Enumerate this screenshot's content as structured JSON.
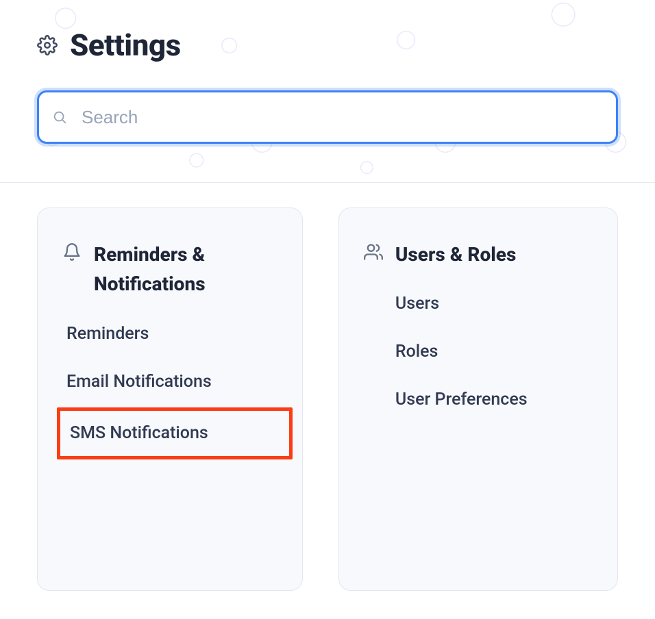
{
  "page": {
    "title": "Settings"
  },
  "search": {
    "placeholder": "Search",
    "value": ""
  },
  "cards": {
    "reminders": {
      "title": "Reminders & Notifications",
      "items": [
        {
          "label": "Reminders",
          "highlighted": false
        },
        {
          "label": "Email Notifications",
          "highlighted": false
        },
        {
          "label": "SMS Notifications",
          "highlighted": true
        }
      ]
    },
    "users": {
      "title": "Users & Roles",
      "items": [
        {
          "label": "Users"
        },
        {
          "label": "Roles"
        },
        {
          "label": "User Preferences"
        }
      ]
    }
  }
}
